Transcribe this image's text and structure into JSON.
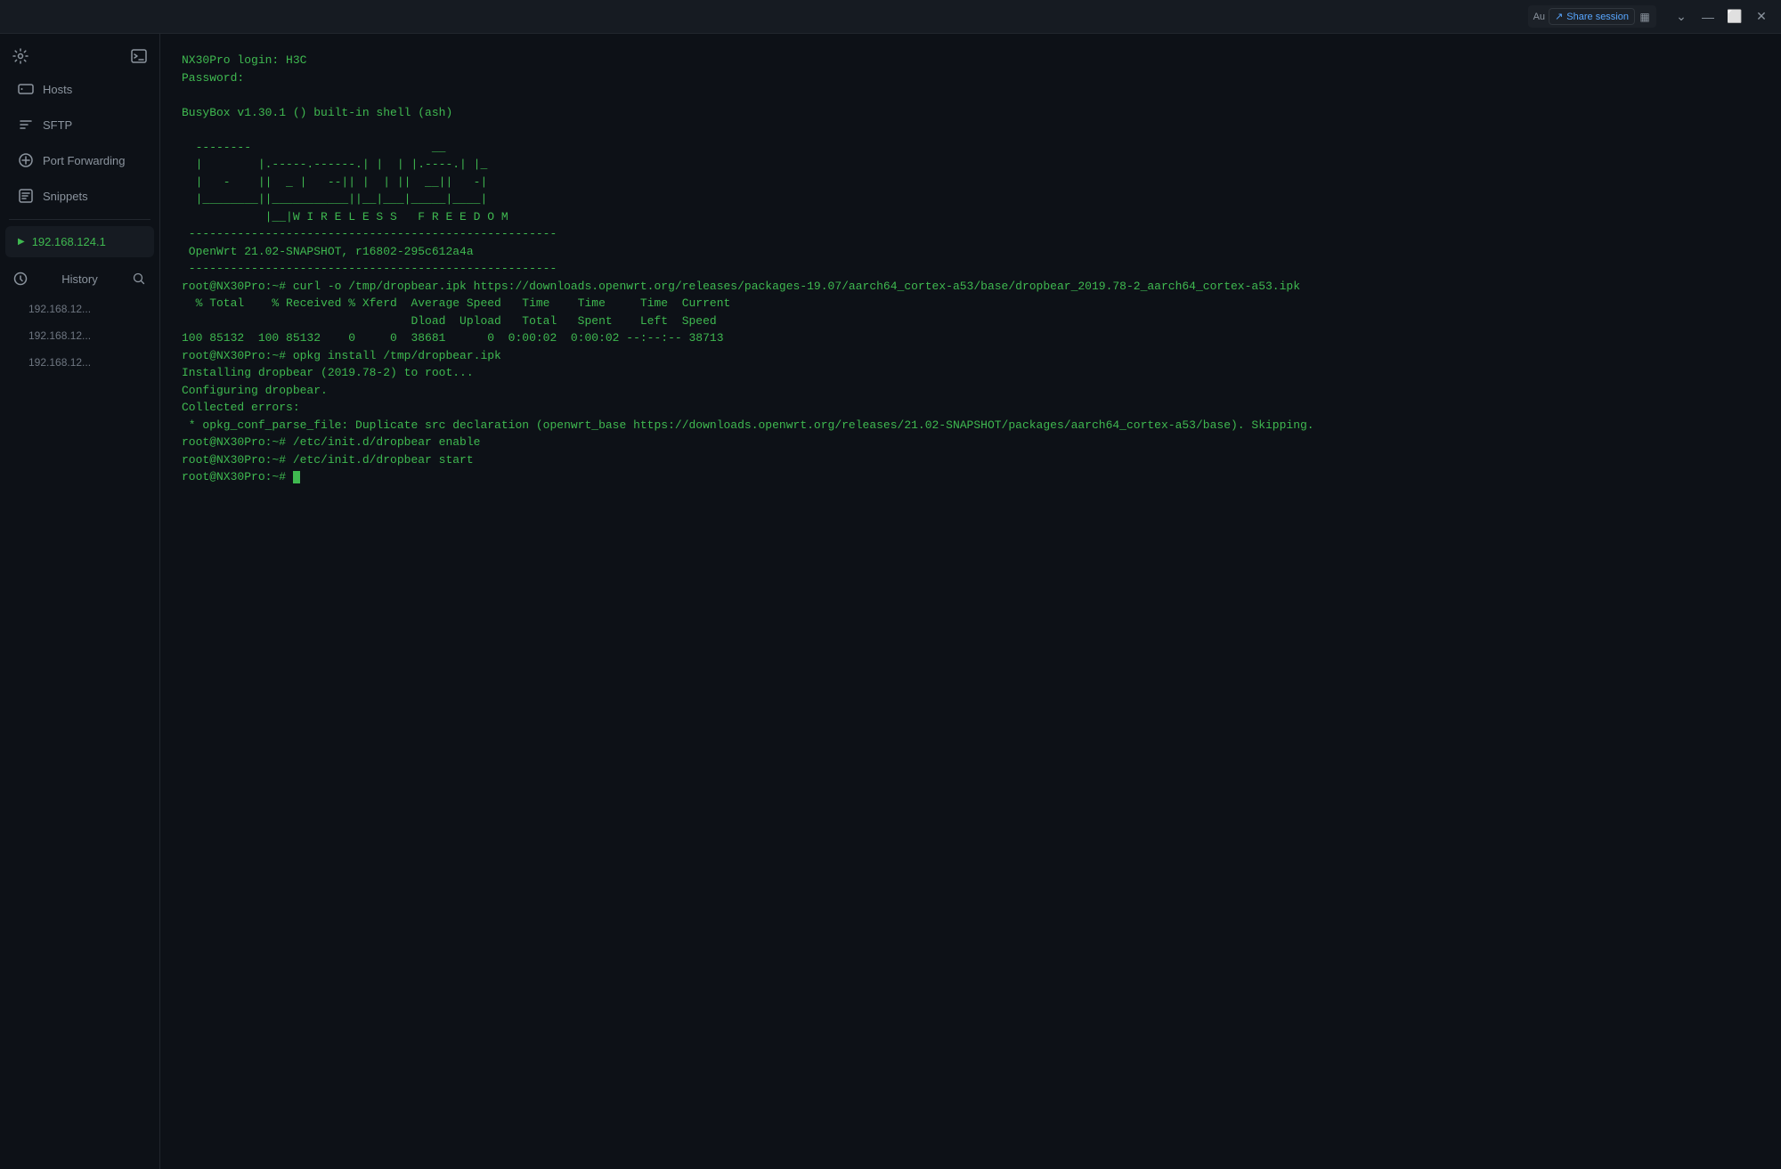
{
  "titlebar": {
    "label": "Au",
    "share_label": "Share session",
    "split_icon": "▦",
    "chevron_down": "⌄",
    "minimize": "—",
    "maximize": "⬜",
    "close": "✕"
  },
  "sidebar": {
    "settings_icon": "⚙",
    "terminal_icon": "⊡",
    "hosts_label": "Hosts",
    "sftp_label": "SFTP",
    "port_forwarding_label": "Port Forwarding",
    "snippets_label": "Snippets",
    "active_host": "192.168.124.1",
    "history_label": "History",
    "search_icon": "🔍",
    "history_items": [
      "192.168.12...",
      "192.168.12...",
      "192.168.12..."
    ]
  },
  "terminal": {
    "lines": [
      "NX30Pro login: H3C",
      "Password:",
      "",
      "BusyBox v1.30.1 () built-in shell (ash)",
      "",
      "  ________        __________",
      " |        |______.|          |     |     |_____.| |_",
      " |   -    ||  _ | |    -----||  |  ||  __||   -|",
      " |________||___________||____|___|_____|____",
      "           |__|W I R E L E S S   F R E E D O M",
      " -----------------------------------------------------",
      " OpenWrt 21.02-SNAPSHOT, r16802-295c612a4a",
      " -----------------------------------------------------",
      "root@NX30Pro:~# curl -o /tmp/dropbear.ipk https://downloads.openwrt.org/releases/packages-19.07/aarch64_cortex-a53/base/dropbear_2019.78-2_aarch64_cortex-a53.ipk",
      "  % Total    % Received % Xferd  Average Speed   Time    Time     Time  Current",
      "                                 Dload  Upload   Total   Spent    Left  Speed",
      "100 85132  100 85132    0     0  38681      0  0:00:02  0:00:02 --:--:-- 38713",
      "root@NX30Pro:~# opkg install /tmp/dropbear.ipk",
      "Installing dropbear (2019.78-2) to root...",
      "Configuring dropbear.",
      "Collected errors:",
      " * opkg_conf_parse_file: Duplicate src declaration (openwrt_base https://downloads.openwrt.org/releases/21.02-SNAPSHOT/packages/aarch64_cortex-a53/base). Skipping.",
      "root@NX30Pro:~# /etc/init.d/dropbear enable",
      "root@NX30Pro:~# /etc/init.d/dropbear start",
      "root@NX30Pro:~# "
    ]
  },
  "colors": {
    "terminal_green": "#3fb950",
    "bg_dark": "#0d1117",
    "sidebar_bg": "#0d1117",
    "border": "#21262d"
  }
}
